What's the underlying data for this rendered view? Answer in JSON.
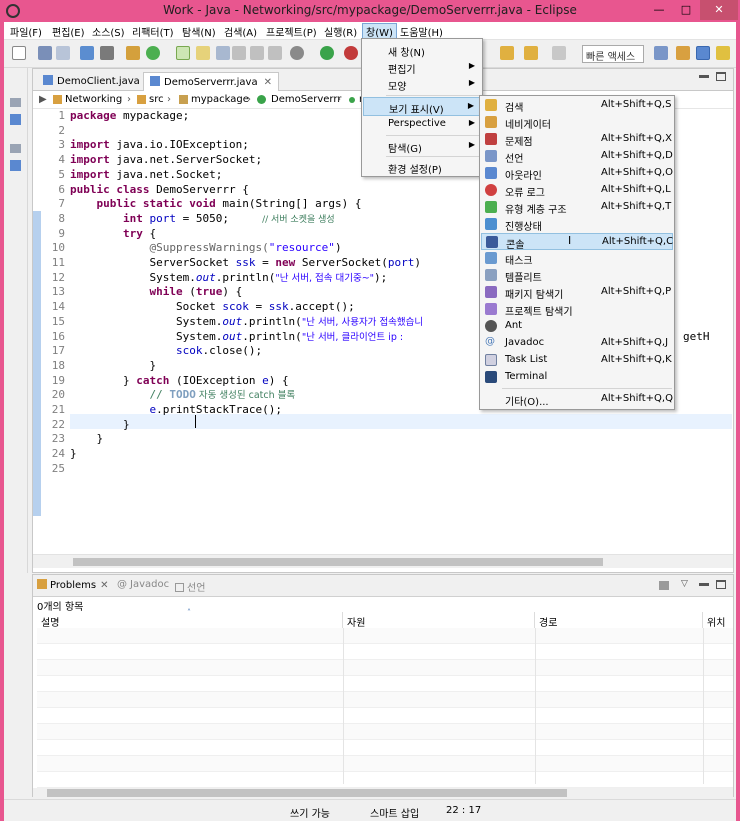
{
  "window": {
    "title": "Work - Java - Networking/src/mypackage/DemoServerrr.java - Eclipse",
    "minimize": "—",
    "maximize": "□",
    "close": "✕"
  },
  "menubar": {
    "items": [
      "파일(F)",
      "편집(E)",
      "소스(S)",
      "리팩터(T)",
      "탐색(N)",
      "검색(A)",
      "프로젝트(P)",
      "실행(R)",
      "창(W)",
      "도움말(H)"
    ]
  },
  "toolbar": {
    "quick_access": "빠른 액세스"
  },
  "editor": {
    "tabs": [
      "DemoClient.java",
      "DemoServerrr.java"
    ],
    "breadcrumb": [
      "Networking",
      "src",
      "mypackage",
      "DemoServerrr",
      "m"
    ],
    "line_numbers": [
      "1",
      "2",
      "3",
      "4",
      "5",
      "6",
      "7",
      "8",
      "9",
      "10",
      "11",
      "12",
      "13",
      "14",
      "15",
      "16",
      "17",
      "18",
      "19",
      "20",
      "21",
      "22",
      "23",
      "24",
      "25"
    ],
    "lines": {
      "l1_kw": "package",
      "l1_rest": " mypackage;",
      "l3_kw": "import",
      "l3_rest": " java.io.IOException;",
      "l4_kw": "import",
      "l4_rest": " java.net.ServerSocket;",
      "l5_kw": "import",
      "l5_rest": " java.net.Socket;",
      "l6_kw1": "public",
      "l6_kw2": "class",
      "l6_rest": " DemoServerrr {",
      "l7_kw1": "public",
      "l7_kw2": "static",
      "l7_kw3": "void",
      "l7_rest": " main(String[] args) {",
      "l8_kw": "int",
      "l8_var": "port",
      "l8_rest": " = 5050;     ",
      "l8_cmt": "// 서버 소켓을 생성",
      "l9_kw": "try",
      "l9_rest": " {",
      "l10_ann": "@SuppressWarnings(",
      "l10_str": "\"resource\"",
      "l10_rest": ")",
      "l11_a": "ServerSocket ",
      "l11_var": "ssk",
      "l11_b": " = ",
      "l11_kw": "new",
      "l11_c": " ServerSocket(",
      "l11_var2": "port",
      "l11_d": ")",
      "l12_a": "System.",
      "l12_st": "out",
      "l12_b": ".println(",
      "l12_str": "\"난 서버, 접속 대기중~\"",
      "l12_c": ");",
      "l13_kw1": "while",
      "l13_a": " (",
      "l13_kw2": "true",
      "l13_b": ") {",
      "l14_a": "Socket ",
      "l14_var": "scok",
      "l14_b": " = ",
      "l14_var2": "ssk",
      "l14_c": ".accept();",
      "l15_a": "System.",
      "l15_st": "out",
      "l15_b": ".println(",
      "l15_str": "\"난 서버, 사용자가 접속했습니",
      "l16_a": "System.",
      "l16_st": "out",
      "l16_b": ".println(",
      "l16_str": "\"난 서버, 클라이언트 ip :",
      "l16_tail": "getH",
      "l17_var": "scok",
      "l17_rest": ".close();",
      "l18": "}",
      "l19_a": "} ",
      "l19_kw": "catch",
      "l19_b": " (IOException ",
      "l19_var": "e",
      "l19_c": ") {",
      "l20_cmt1": "// ",
      "l20_todo": "TODO",
      "l20_cmt2": " 자동 생성된 catch 블록",
      "l21_var": "e",
      "l21_rest": ".printStackTrace();",
      "l22": "}",
      "l23": "}",
      "l24": "}"
    }
  },
  "bottom_panel": {
    "tabs": [
      "Problems",
      "Javadoc",
      "선언"
    ],
    "item_count": "0개의 항목",
    "columns": [
      "설명",
      "자원",
      "경로",
      "위치"
    ]
  },
  "statusbar": {
    "writable": "쓰기 가능",
    "insert_mode": "스마트 삽입",
    "position": "22 : 17"
  },
  "window_menu": {
    "items": [
      "새 창(N)",
      "편집기",
      "모양",
      "보기 표시(V)",
      "Perspective",
      "탐색(G)",
      "환경 설정(P)"
    ]
  },
  "show_view_submenu": {
    "items": [
      {
        "label": "검색",
        "shortcut": "Alt+Shift+Q,S",
        "icon": "search-icon"
      },
      {
        "label": "네비게이터",
        "shortcut": "",
        "icon": "navigator-icon"
      },
      {
        "label": "문제점",
        "shortcut": "Alt+Shift+Q,X",
        "icon": "problems-icon"
      },
      {
        "label": "선언",
        "shortcut": "Alt+Shift+Q,D",
        "icon": "declaration-icon"
      },
      {
        "label": "아웃라인",
        "shortcut": "Alt+Shift+Q,O",
        "icon": "outline-icon"
      },
      {
        "label": "오류 로그",
        "shortcut": "Alt+Shift+Q,L",
        "icon": "error-log-icon"
      },
      {
        "label": "유형 계층 구조",
        "shortcut": "Alt+Shift+Q,T",
        "icon": "hierarchy-icon"
      },
      {
        "label": "진행상태",
        "shortcut": "",
        "icon": "progress-icon"
      },
      {
        "label": "콘솔",
        "shortcut": "Alt+Shift+Q,C",
        "icon": "console-icon"
      },
      {
        "label": "태스크",
        "shortcut": "",
        "icon": "tasks-icon"
      },
      {
        "label": "템플리트",
        "shortcut": "",
        "icon": "templates-icon"
      },
      {
        "label": "패키지 탐색기",
        "shortcut": "Alt+Shift+Q,P",
        "icon": "package-explorer-icon"
      },
      {
        "label": "프로젝트 탐색기",
        "shortcut": "",
        "icon": "project-explorer-icon"
      },
      {
        "label": "Ant",
        "shortcut": "",
        "icon": "ant-icon"
      },
      {
        "label": "Javadoc",
        "shortcut": "Alt+Shift+Q,J",
        "icon": "javadoc-icon"
      },
      {
        "label": "Task List",
        "shortcut": "Alt+Shift+Q,K",
        "icon": "task-list-icon"
      },
      {
        "label": "Terminal",
        "shortcut": "",
        "icon": "terminal-icon"
      },
      {
        "label": "기타(O)...",
        "shortcut": "Alt+Shift+Q,Q",
        "icon": ""
      }
    ]
  },
  "colors": {
    "title_bar": "#e8568f",
    "selection": "#cce4f7",
    "keyword": "#7f0055",
    "string": "#2a00ff",
    "comment": "#3f7f5f"
  }
}
